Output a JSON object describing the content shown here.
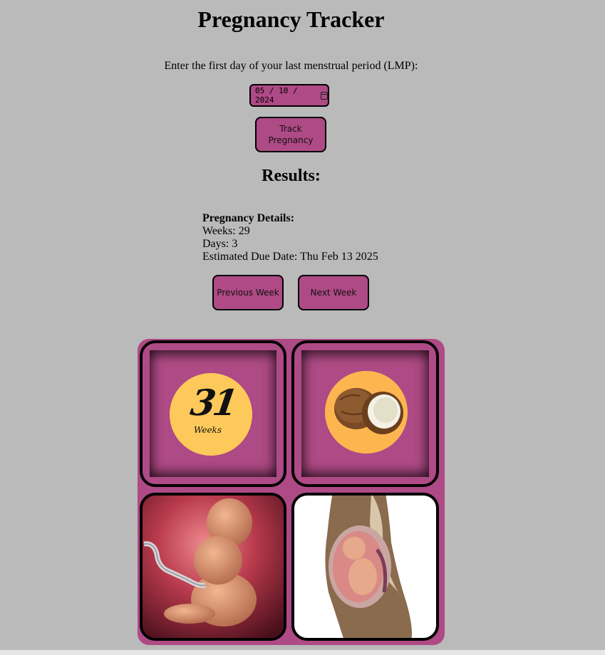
{
  "app": {
    "title": "Pregnancy Tracker"
  },
  "form": {
    "lmp_label": "Enter the first day of your last menstrual period (LMP):",
    "date_value": "05 / 10 / 2024",
    "track_button": "Track Pregnancy"
  },
  "results": {
    "heading": "Results:",
    "details_title": "Pregnancy Details:",
    "weeks": "Weeks: 29",
    "days": "Days: 3",
    "due_date": "Estimated Due Date: Thu Feb 13 2025"
  },
  "nav": {
    "previous": "Previous Week",
    "next": "Next Week"
  },
  "gallery": {
    "week_number": "31",
    "week_word": "Weeks",
    "images": [
      "week-badge",
      "coconut-size",
      "fetus-illustration",
      "womb-cross-section"
    ]
  },
  "colors": {
    "background": "#bababa",
    "accent": "#ae4a85",
    "badge_yellow": "#fdc95a",
    "coconut_circle": "#fdb64f"
  }
}
